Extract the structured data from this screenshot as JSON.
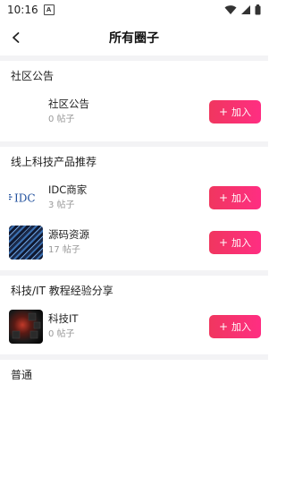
{
  "status_bar": {
    "time": "10:16",
    "notification_badge": "A"
  },
  "header": {
    "title": "所有圈子"
  },
  "sections": [
    {
      "title": "社区公告",
      "items": [
        {
          "name": "社区公告",
          "posts": "0 帖子",
          "join_label": "加入",
          "thumb": "none"
        }
      ]
    },
    {
      "title": "线上科技产品推荐",
      "items": [
        {
          "name": "IDC商家",
          "posts": "3 帖子",
          "join_label": "加入",
          "thumb": "idc-logo",
          "logo_text": "IDC"
        },
        {
          "name": "源码资源",
          "posts": "17 帖子",
          "join_label": "加入",
          "thumb": "code-image"
        }
      ]
    },
    {
      "title": "科技/IT 教程经验分享",
      "items": [
        {
          "name": "科技IT",
          "posts": "0 帖子",
          "join_label": "加入",
          "thumb": "tech-image"
        }
      ]
    },
    {
      "title": "普通",
      "items": []
    }
  ],
  "colors": {
    "accent": "#f0365f",
    "divider": "#f3f3f5"
  }
}
